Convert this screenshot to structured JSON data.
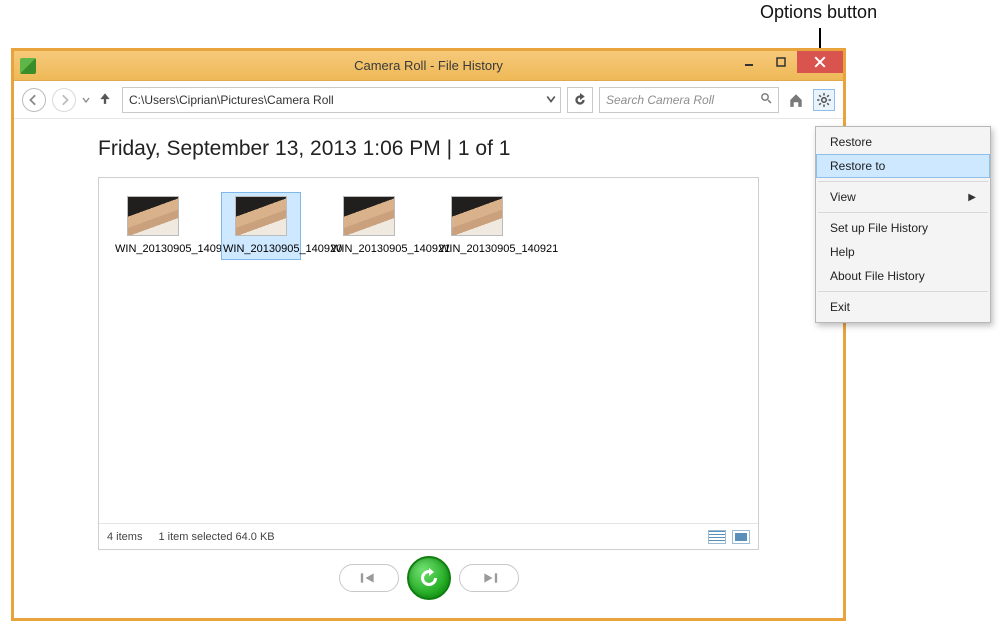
{
  "callout": {
    "label": "Options button"
  },
  "window": {
    "title": "Camera Roll - File History"
  },
  "nav": {
    "address": "C:\\Users\\Ciprian\\Pictures\\Camera Roll",
    "search_placeholder": "Search Camera Roll"
  },
  "content": {
    "heading": "Friday, September 13, 2013 1:06 PM   |   1 of 1"
  },
  "files": {
    "items": [
      {
        "name": "WIN_20130905_140904",
        "selected": false
      },
      {
        "name": "WIN_20130905_140920",
        "selected": true
      },
      {
        "name": "WIN_20130905_140921",
        "selected": false
      },
      {
        "name": "WIN_20130905_140921",
        "selected": false
      }
    ],
    "status_count": "4 items",
    "status_selection": "1 item selected   64.0 KB"
  },
  "options_menu": {
    "restore": "Restore",
    "restore_to": "Restore to",
    "view": "View",
    "setup": "Set up File History",
    "help": "Help",
    "about": "About File History",
    "exit": "Exit"
  }
}
